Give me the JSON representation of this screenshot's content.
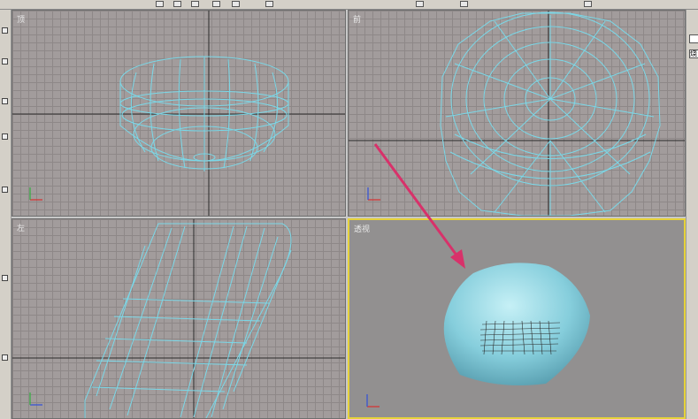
{
  "toolbar": {
    "icons": [
      "select-arrow-icon",
      "select-region-icon",
      "move-icon",
      "rotate-icon",
      "scale-icon",
      "link-icon",
      "mirror-icon",
      "align-icon",
      "render-icon"
    ]
  },
  "viewports": {
    "top": {
      "label": "顶"
    },
    "front": {
      "label": "前"
    },
    "left": {
      "label": "左"
    },
    "perspective": {
      "label": "透视"
    }
  },
  "right_panel": {
    "field_char": "烧"
  },
  "colors": {
    "wire": "#7ad8e8",
    "grid_bg": "#a29c9c",
    "active_border": "#e6d23a",
    "arrow": "#d8316a"
  }
}
